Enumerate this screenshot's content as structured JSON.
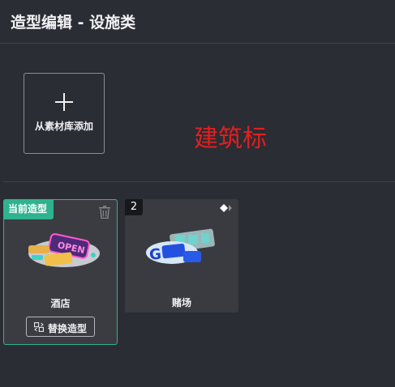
{
  "header": {
    "title": "造型编辑 - 设施类"
  },
  "add_card": {
    "label": "从素材库添加",
    "icon": "plus-icon"
  },
  "overlay_note": {
    "text": "建筑标",
    "color": "#e02020"
  },
  "cards": [
    {
      "name": "酒店",
      "badge": "当前造型",
      "is_current": true,
      "button_label": "替换造型",
      "accent": "#2fb38f"
    },
    {
      "name": "赌场",
      "badge": "2",
      "is_current": false
    }
  ]
}
